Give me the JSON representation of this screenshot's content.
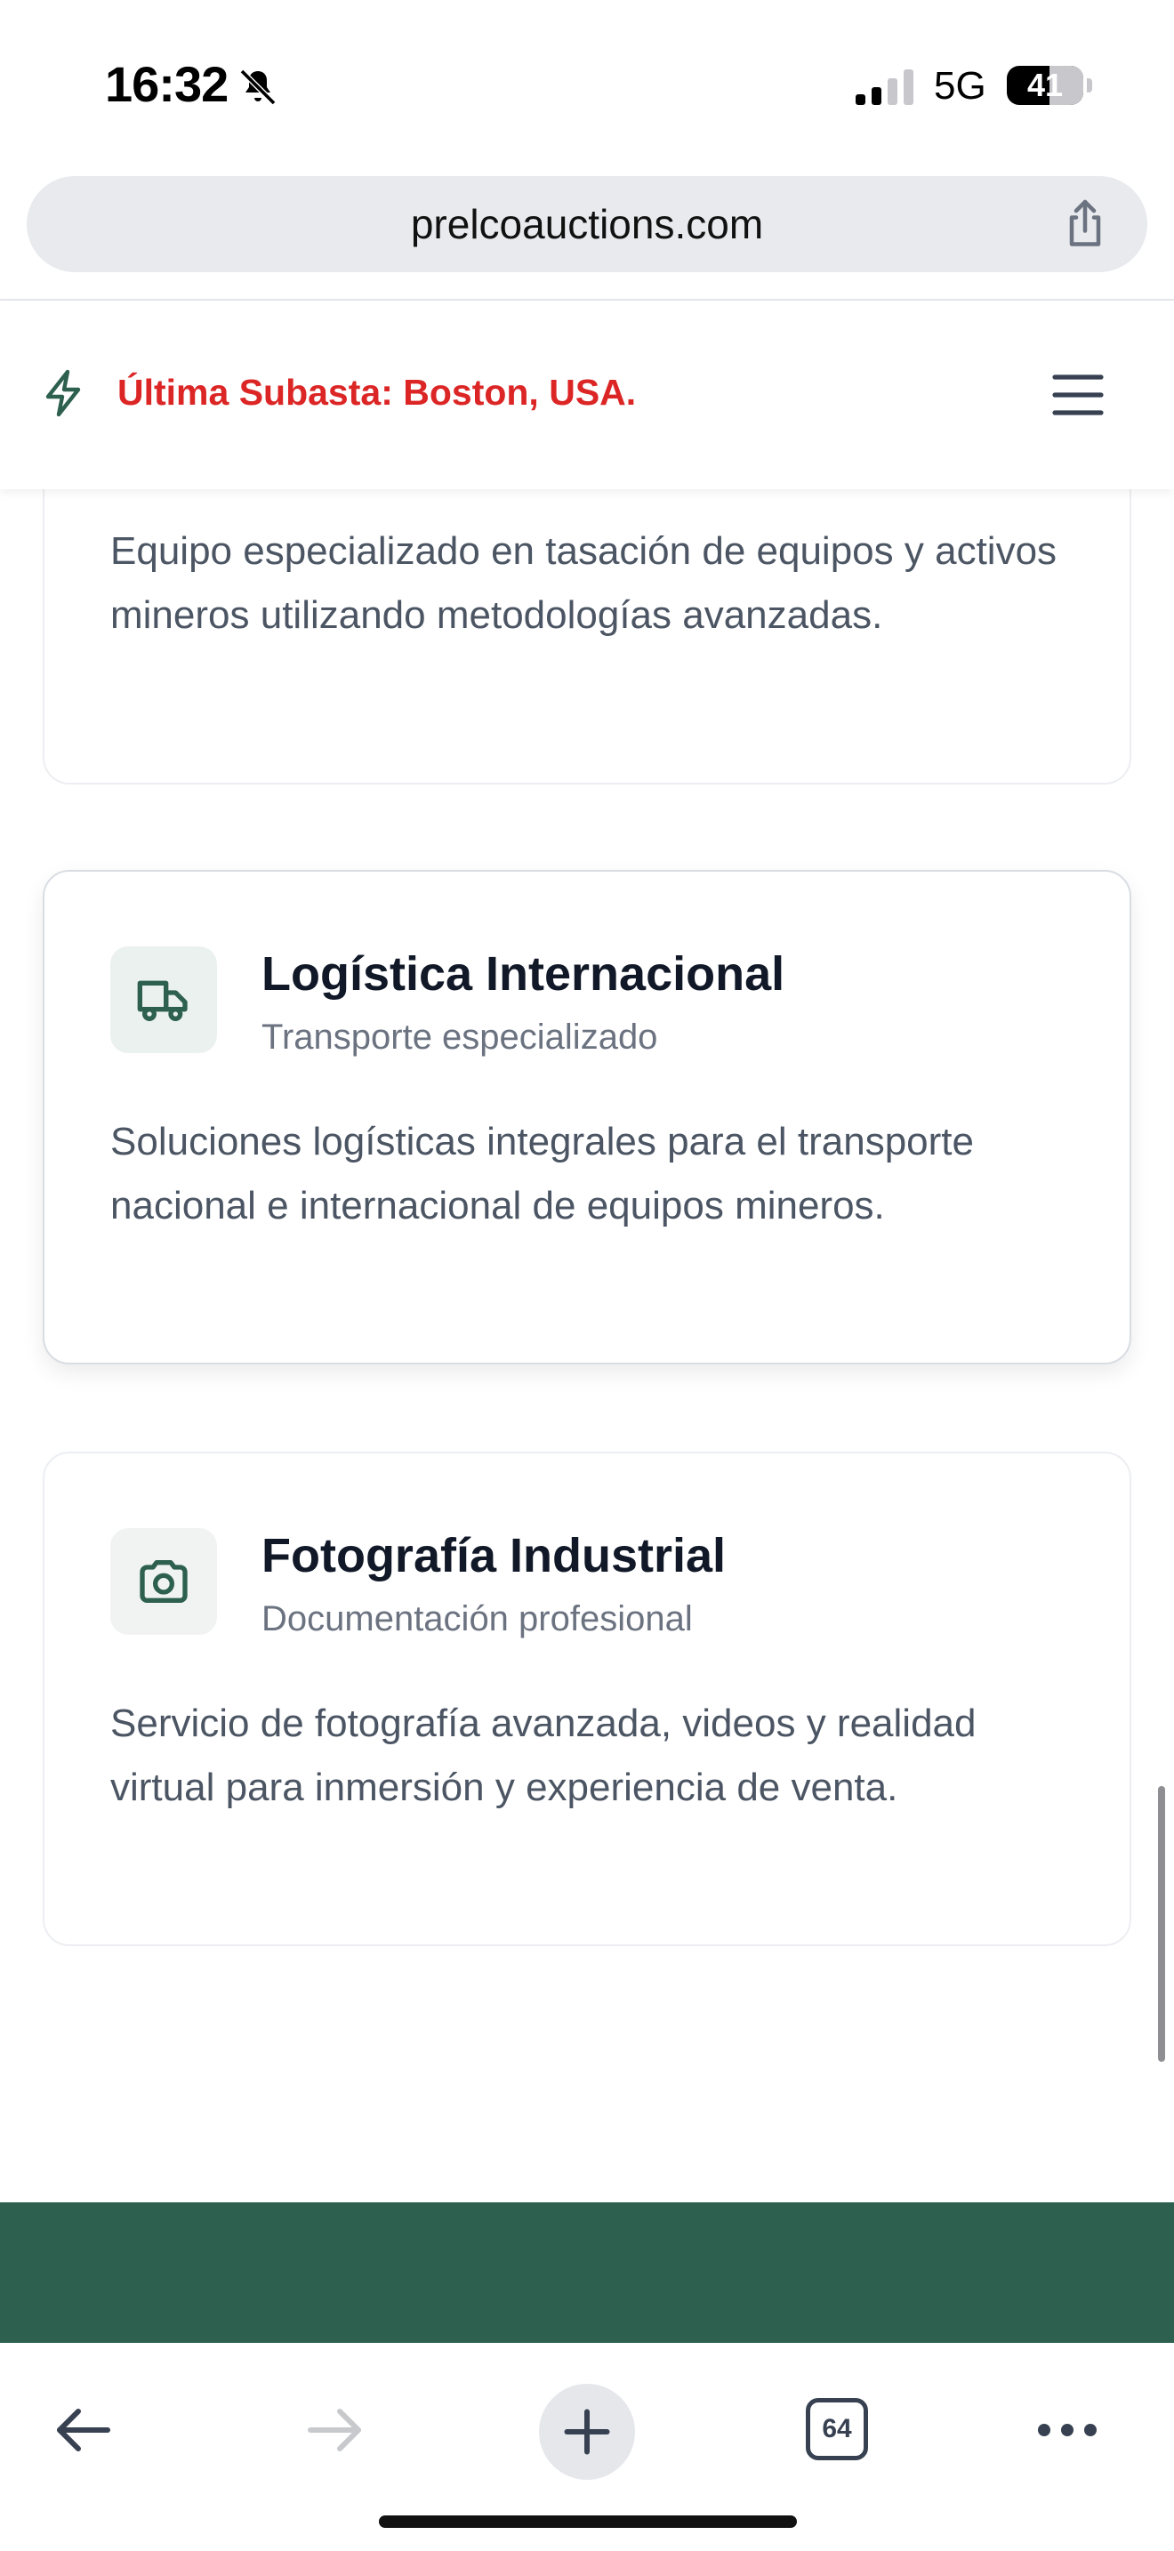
{
  "status_bar": {
    "time": "16:32",
    "network": "5G",
    "battery_level": "41"
  },
  "browser": {
    "url": "prelcoauctions.com",
    "tab_count": "64"
  },
  "header": {
    "announcement": "Última Subasta: Boston, USA."
  },
  "services": [
    {
      "title": "",
      "subtitle": "",
      "description": "Equipo especializado en tasación de equipos y activos mineros utilizando metodologías avanzadas.",
      "icon": "partial-hidden"
    },
    {
      "title": "Logística Internacional",
      "subtitle": "Transporte especializado",
      "description": "Soluciones logísticas integrales para el transporte nacional e internacional de equipos mineros.",
      "icon": "truck-icon"
    },
    {
      "title": "Fotografía Industrial",
      "subtitle": "Documentación profesional",
      "description": "Servicio de fotografía avanzada, videos y realidad virtual para inmersión y experiencia de venta.",
      "icon": "camera-icon"
    }
  ],
  "colors": {
    "brand_green": "#2d604e",
    "announcement_red": "#dc2626",
    "text_gray": "#4b5563"
  }
}
